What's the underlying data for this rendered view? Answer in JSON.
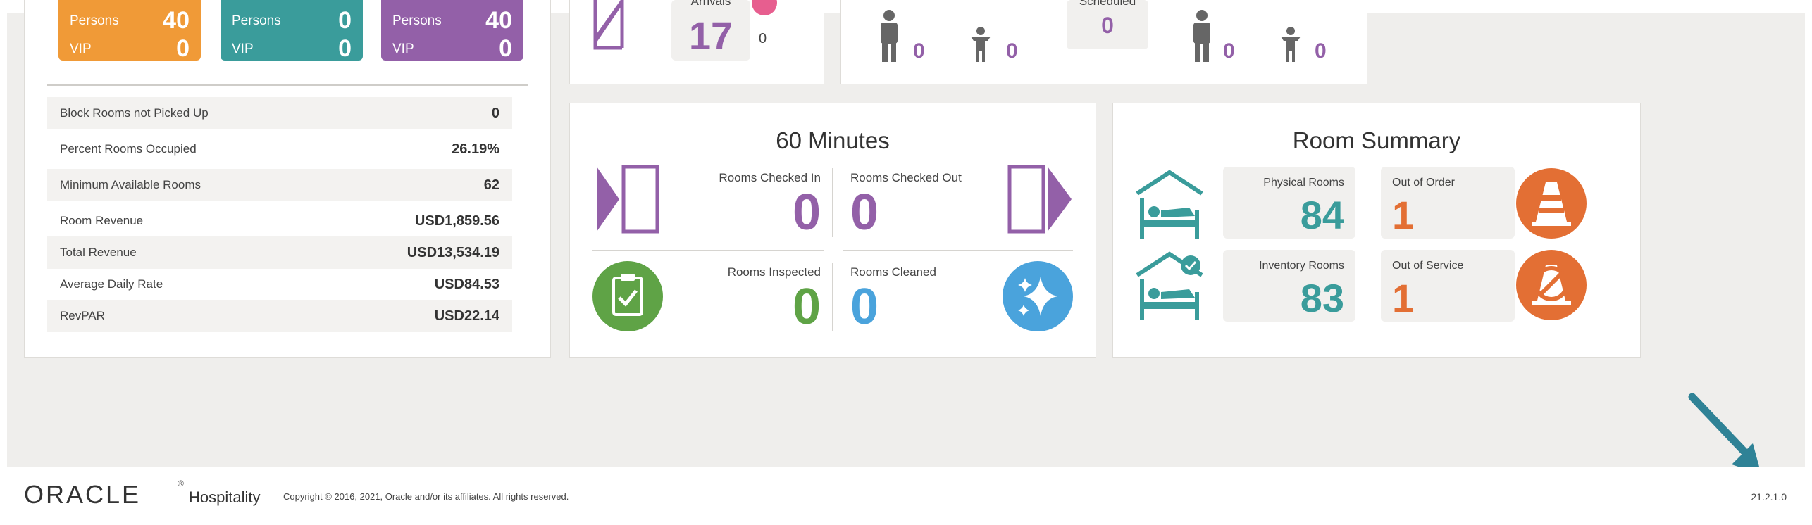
{
  "tiles": [
    {
      "persons_label": "Persons",
      "persons_value": "40",
      "vip_label": "VIP",
      "vip_value": "0"
    },
    {
      "persons_label": "Persons",
      "persons_value": "0",
      "vip_label": "VIP",
      "vip_value": "0"
    },
    {
      "persons_label": "Persons",
      "persons_value": "40",
      "vip_label": "VIP",
      "vip_value": "0"
    }
  ],
  "stats": [
    {
      "label": "Block Rooms not Picked Up",
      "value": "0"
    },
    {
      "label": "Percent Rooms Occupied",
      "value": "26.19%"
    },
    {
      "label": "Minimum Available Rooms",
      "value": "62"
    },
    {
      "label": "Room Revenue",
      "value": "USD1,859.56"
    },
    {
      "label": "Total Revenue",
      "value": "USD13,534.19"
    },
    {
      "label": "Average Daily Rate",
      "value": "USD84.53"
    },
    {
      "label": "RevPAR",
      "value": "USD22.14"
    }
  ],
  "arrivals": {
    "label": "Arrivals",
    "value": "17",
    "badge": "0"
  },
  "guests": {
    "adults_1": "0",
    "children_1": "0",
    "scheduled_label": "Scheduled",
    "scheduled_value": "0",
    "adults_2": "0",
    "children_2": "0"
  },
  "sixty_minutes": {
    "title": "60 Minutes",
    "checked_in_label": "Rooms Checked In",
    "checked_in_value": "0",
    "checked_out_label": "Rooms Checked Out",
    "checked_out_value": "0",
    "inspected_label": "Rooms Inspected",
    "inspected_value": "0",
    "cleaned_label": "Rooms Cleaned",
    "cleaned_value": "0"
  },
  "room_summary": {
    "title": "Room Summary",
    "physical_label": "Physical Rooms",
    "physical_value": "84",
    "inventory_label": "Inventory Rooms",
    "inventory_value": "83",
    "out_of_order_label": "Out of Order",
    "out_of_order_value": "1",
    "out_of_service_label": "Out of Service",
    "out_of_service_value": "1"
  },
  "footer": {
    "brand": "ORACLE",
    "product": "Hospitality",
    "copyright": "Copyright © 2016, 2021, Oracle and/or its affiliates. All rights reserved.",
    "version": "21.2.1.0"
  },
  "colors": {
    "orange": "#f09a37",
    "teal": "#3a9c9b",
    "purple": "#9360a8",
    "green": "#5fa346",
    "blue": "#4aa3dc",
    "red_orange": "#e36f34",
    "annotation_arrow": "#2f8296"
  }
}
